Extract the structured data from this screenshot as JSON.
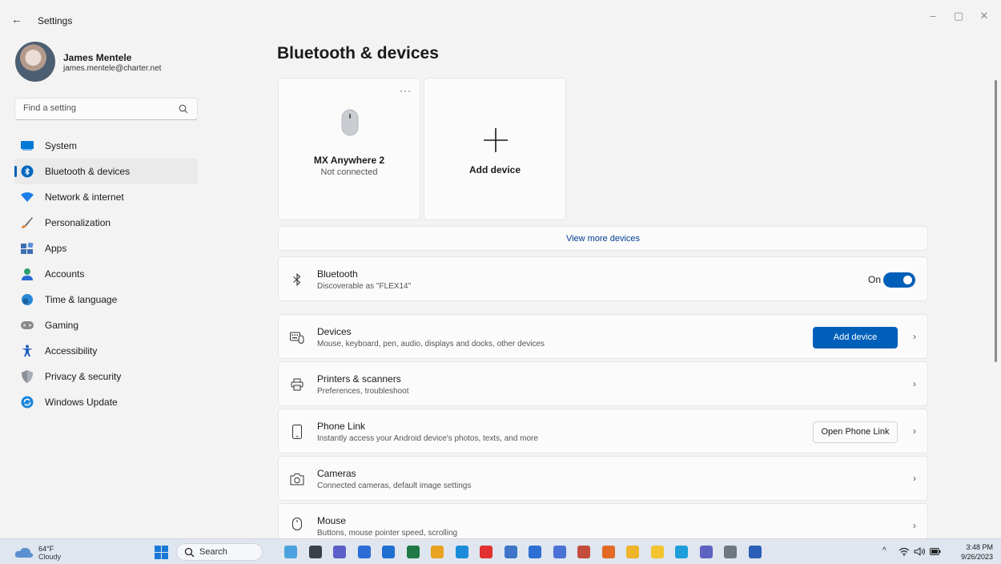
{
  "window": {
    "title": "Settings",
    "back_glyph": "←",
    "controls": {
      "minimize": "–",
      "maximize": "▢",
      "close": "✕"
    }
  },
  "profile": {
    "name": "James Mentele",
    "email": "james.mentele@charter.net"
  },
  "search": {
    "placeholder": "Find a setting"
  },
  "nav": {
    "items": [
      {
        "label": "System",
        "icon": "system-icon",
        "color": "#0078d4"
      },
      {
        "label": "Bluetooth & devices",
        "icon": "bluetooth-icon",
        "color": "#0067c0",
        "active": true
      },
      {
        "label": "Network & internet",
        "icon": "wifi-icon",
        "color": "#1b7ee6"
      },
      {
        "label": "Personalization",
        "icon": "brush-icon",
        "color": "#e0883a"
      },
      {
        "label": "Apps",
        "icon": "apps-icon",
        "color": "#3f6fb0"
      },
      {
        "label": "Accounts",
        "icon": "person-icon",
        "color": "#2ca06c"
      },
      {
        "label": "Time & language",
        "icon": "globe-clock-icon",
        "color": "#2b88d8"
      },
      {
        "label": "Gaming",
        "icon": "gamepad-icon",
        "color": "#8a8a8a"
      },
      {
        "label": "Accessibility",
        "icon": "accessibility-icon",
        "color": "#1d5fbf"
      },
      {
        "label": "Privacy & security",
        "icon": "shield-icon",
        "color": "#8a8f99"
      },
      {
        "label": "Windows Update",
        "icon": "update-icon",
        "color": "#1a86d9"
      }
    ]
  },
  "main": {
    "title": "Bluetooth & devices",
    "device_card": {
      "name": "MX Anywhere 2",
      "status": "Not connected",
      "more": "···"
    },
    "add_card": {
      "plus": "+",
      "label": "Add device"
    },
    "view_more": "View more devices",
    "bluetooth": {
      "title": "Bluetooth",
      "subtitle": "Discoverable as \"FLEX14\"",
      "state": "On"
    },
    "rows": [
      {
        "title": "Devices",
        "subtitle": "Mouse, keyboard, pen, audio, displays and docks, other devices",
        "button": "Add device",
        "button_kind": "primary"
      },
      {
        "title": "Printers & scanners",
        "subtitle": "Preferences, troubleshoot"
      },
      {
        "title": "Phone Link",
        "subtitle": "Instantly access your Android device's photos, texts, and more",
        "button": "Open Phone Link",
        "button_kind": "secondary"
      },
      {
        "title": "Cameras",
        "subtitle": "Connected cameras, default image settings"
      },
      {
        "title": "Mouse",
        "subtitle": "Buttons, mouse pointer speed, scrolling"
      }
    ],
    "chevron": "›"
  },
  "taskbar": {
    "weather": {
      "temp": "64°F",
      "condition": "Cloudy"
    },
    "search_label": "Search",
    "tray": {
      "chevron": "^"
    },
    "clock": {
      "time": "3:48 PM",
      "date": "9/26/2023"
    },
    "apps": [
      {
        "name": "edge-game-app-icon",
        "color": "#4aa3df"
      },
      {
        "name": "task-view-icon",
        "color": "#3a3f4a"
      },
      {
        "name": "meet-app-icon",
        "color": "#5b5fc7"
      },
      {
        "name": "notepad-icon",
        "color": "#2b6cd6"
      },
      {
        "name": "mail-app-icon",
        "color": "#1f6fd1"
      },
      {
        "name": "excel-icon",
        "color": "#1d7a46"
      },
      {
        "name": "chrome-icon",
        "color": "#e9a321"
      },
      {
        "name": "edge-icon",
        "color": "#1b8bd8"
      },
      {
        "name": "youtube-icon",
        "color": "#e03030"
      },
      {
        "name": "remote-desktop-icon",
        "color": "#3d76c9"
      },
      {
        "name": "store-icon",
        "color": "#2d6fd3"
      },
      {
        "name": "snipping-tool-icon",
        "color": "#4a72d6"
      },
      {
        "name": "office-app-icon",
        "color": "#c44d3e"
      },
      {
        "name": "firefox-icon",
        "color": "#e36a24"
      },
      {
        "name": "chrome-alt-icon",
        "color": "#f0b429"
      },
      {
        "name": "file-explorer-icon",
        "color": "#f4c430"
      },
      {
        "name": "bing-icon",
        "color": "#1c9ed9"
      },
      {
        "name": "teams-icon",
        "color": "#5e62c2"
      },
      {
        "name": "settings-app-icon",
        "color": "#6e7780"
      },
      {
        "name": "word-icon",
        "color": "#2b5fb6"
      }
    ]
  }
}
